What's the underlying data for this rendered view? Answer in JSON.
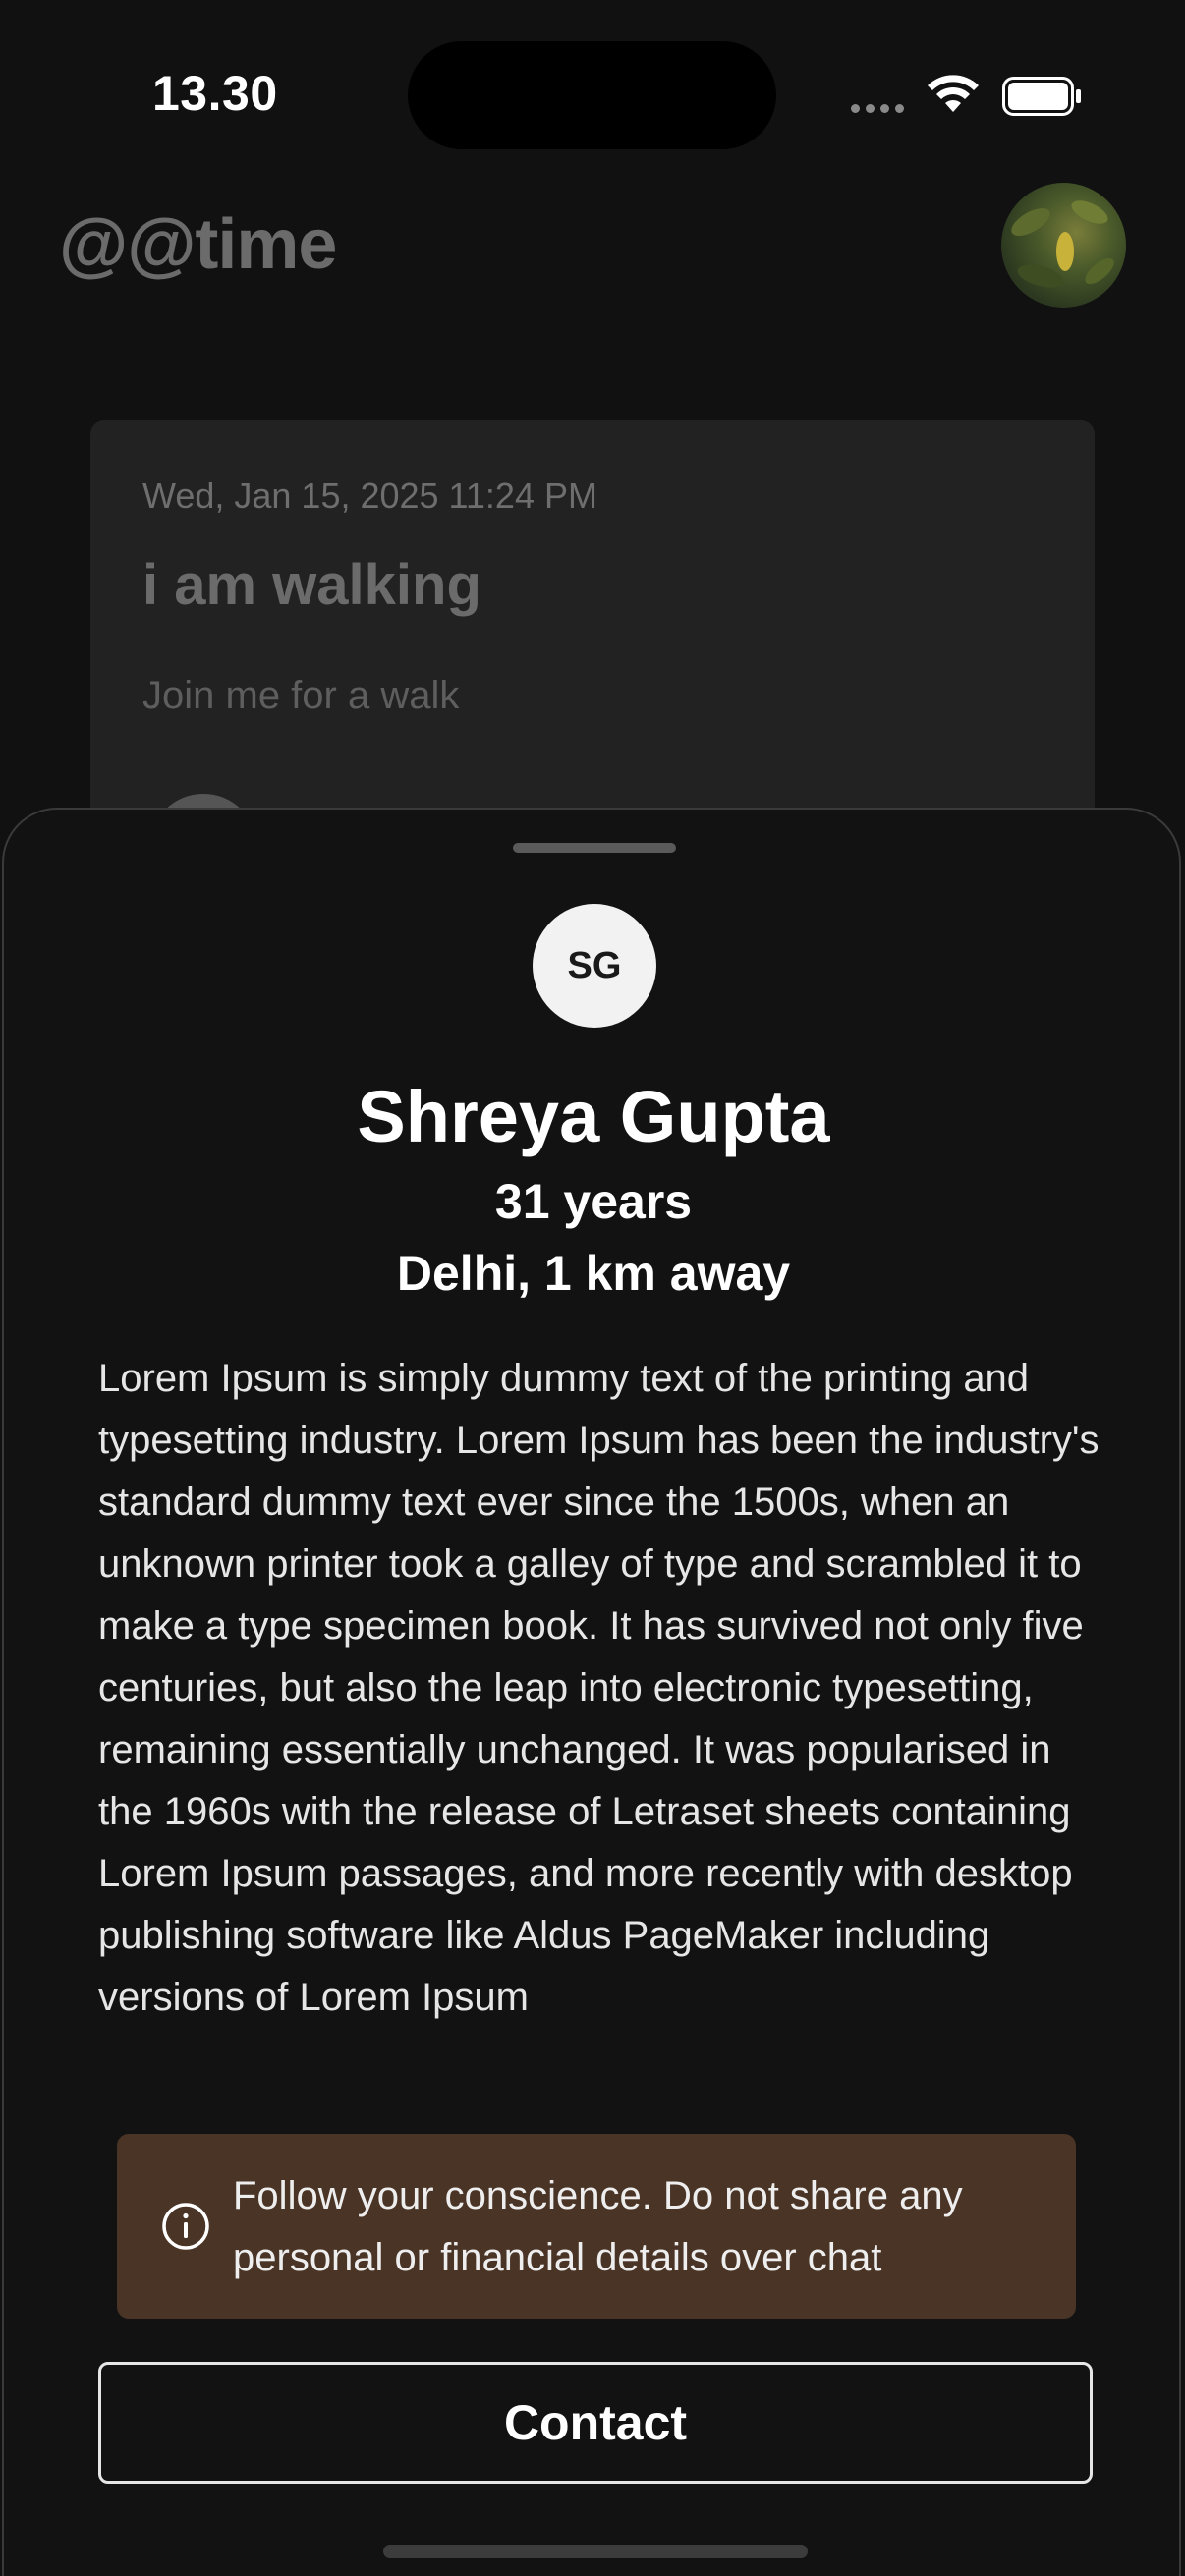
{
  "status_bar": {
    "time": "13.30"
  },
  "app": {
    "title": "@@time",
    "profile_photo_icon": "profile-photo"
  },
  "post": {
    "date": "Wed, Jan 15, 2025 11:24 PM",
    "title": "i am walking",
    "description": "Join me for a walk"
  },
  "sheet": {
    "avatar_initials": "SG",
    "name": "Shreya Gupta",
    "age": "31 years",
    "location": "Delhi, 1 km away",
    "bio": "Lorem Ipsum is simply dummy text of the printing and typesetting industry. Lorem Ipsum has been the industry's standard dummy text ever since the 1500s, when an unknown printer took a galley of type and scrambled it to make a type specimen book. It has survived not only five centuries, but also the leap into electronic typesetting, remaining essentially unchanged. It was popularised in the 1960s with the release of Letraset sheets containing Lorem Ipsum passages, and more recently with desktop publishing software like Aldus PageMaker including versions of Lorem Ipsum",
    "warning_icon": "info-icon",
    "warning_text": "Follow your conscience. Do not share any personal or financial details over chat",
    "contact_label": "Contact"
  },
  "colors": {
    "sheet_background": "#121212",
    "warning_background": "#4a3426",
    "dimmed_text": "#6b6b6b"
  }
}
